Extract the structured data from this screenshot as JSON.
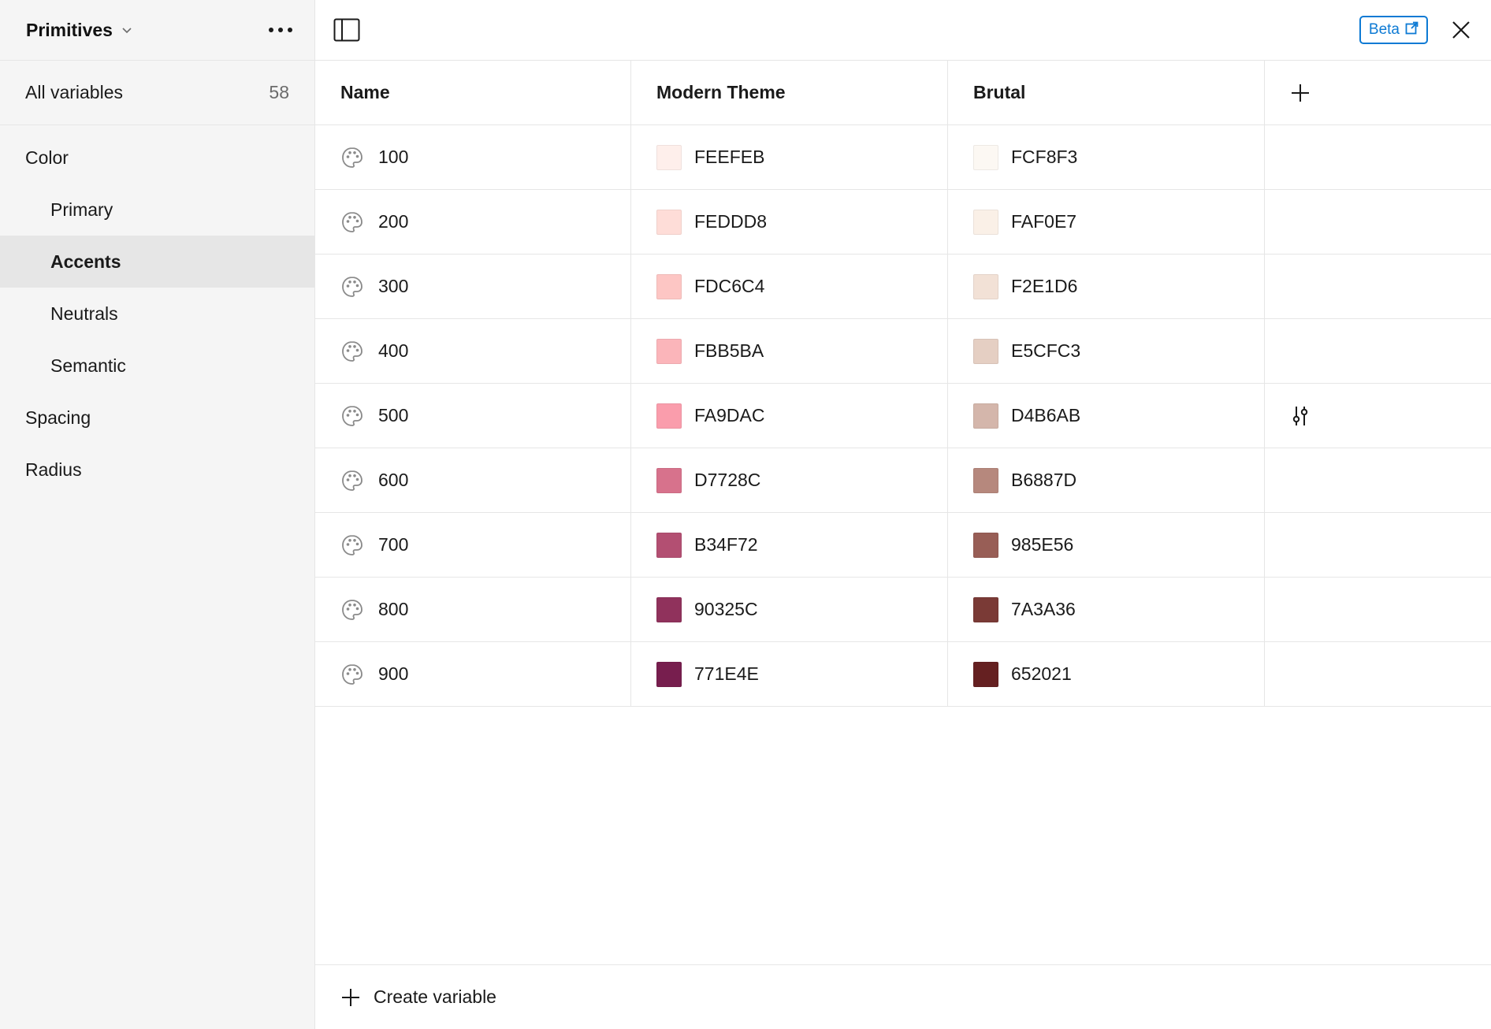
{
  "sidebar": {
    "collection_title": "Primitives",
    "all_variables": {
      "label": "All variables",
      "count": "58"
    },
    "groups": [
      {
        "label": "Color",
        "level": 0,
        "active": false
      },
      {
        "label": "Primary",
        "level": 1,
        "active": false
      },
      {
        "label": "Accents",
        "level": 1,
        "active": true
      },
      {
        "label": "Neutrals",
        "level": 1,
        "active": false
      },
      {
        "label": "Semantic",
        "level": 1,
        "active": false
      },
      {
        "label": "Spacing",
        "level": 0,
        "active": false
      },
      {
        "label": "Radius",
        "level": 0,
        "active": false
      }
    ]
  },
  "topbar": {
    "beta_label": "Beta",
    "icons": [
      "panel-toggle-icon",
      "external-link-icon",
      "close-icon"
    ]
  },
  "table": {
    "headers": {
      "name": "Name",
      "mode1": "Modern Theme",
      "mode2": "Brutal"
    },
    "rows": [
      {
        "name": "100",
        "mode1": "FEEFEB",
        "mode2": "FCF8F3"
      },
      {
        "name": "200",
        "mode1": "FEDDD8",
        "mode2": "FAF0E7"
      },
      {
        "name": "300",
        "mode1": "FDC6C4",
        "mode2": "F2E1D6"
      },
      {
        "name": "400",
        "mode1": "FBB5BA",
        "mode2": "E5CFC3"
      },
      {
        "name": "500",
        "mode1": "FA9DAC",
        "mode2": "D4B6AB"
      },
      {
        "name": "600",
        "mode1": "D7728C",
        "mode2": "B6887D"
      },
      {
        "name": "700",
        "mode1": "B34F72",
        "mode2": "985E56"
      },
      {
        "name": "800",
        "mode1": "90325C",
        "mode2": "7A3A36"
      },
      {
        "name": "900",
        "mode1": "771E4E",
        "mode2": "652021"
      }
    ],
    "hover_row_index": 4
  },
  "footer": {
    "create_label": "Create variable"
  },
  "colors": {
    "accent": "#0d7ad4",
    "sidebar_bg": "#f5f5f5",
    "active_bg": "#e6e6e6"
  }
}
